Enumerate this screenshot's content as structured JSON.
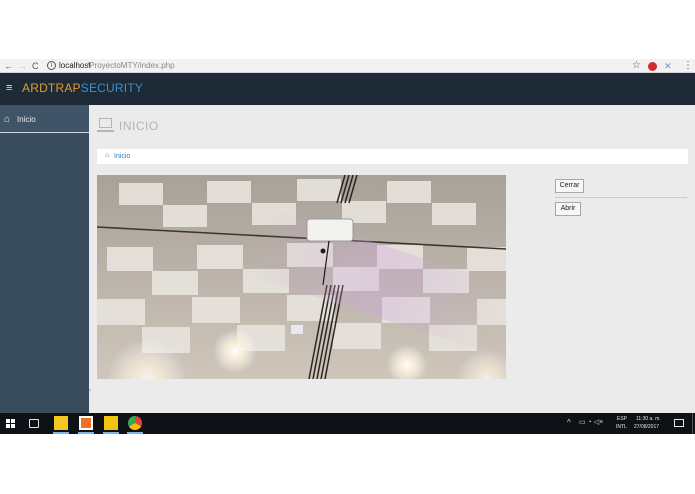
{
  "browser": {
    "back_icon": "←",
    "forward_icon": "→",
    "reload_icon": "C",
    "info_icon": "i",
    "address_host": "localhost",
    "address_path": "/ProyectoMTY/index.php",
    "star_icon": "☆",
    "menu_icon": "⋮"
  },
  "header": {
    "menu_icon": "≡",
    "brand_primary": "ARDTRAP",
    "brand_secondary": "SECURITY",
    "colors": {
      "background": "#1e2a36",
      "brand_primary": "#e09a3a",
      "brand_secondary": "#3a91c9"
    }
  },
  "sidebar": {
    "items": [
      {
        "label": "Inicio",
        "icon": "home-icon",
        "glyph": "⌂"
      }
    ],
    "colors": {
      "background": "#394c5e"
    }
  },
  "main": {
    "page_title": "INICIO",
    "breadcrumb": {
      "icon": "home-icon",
      "glyph": "⌂",
      "label": "Inicio"
    },
    "camera_feed": {
      "description_icon": "camera-feed"
    },
    "buttons": {
      "close_label": "Cerrar",
      "open_label": "Abrir"
    },
    "collapse_glyph": "‹"
  },
  "taskbar": {
    "language_line1": "ESP",
    "language_line2": "INTL",
    "time": "11:30 a. m.",
    "date": "27/08/2017",
    "tray_arrow": "^",
    "tray_icons_text": "▭ ◔ ◁×",
    "apps": [
      {
        "icon": "sticky-notes-icon",
        "color": "#f3c623"
      },
      {
        "icon": "xampp-icon",
        "color": "#f37021"
      },
      {
        "icon": "file-explorer-icon",
        "color": "#f1c40f"
      },
      {
        "icon": "chrome-icon",
        "color": "#e34133"
      }
    ]
  }
}
